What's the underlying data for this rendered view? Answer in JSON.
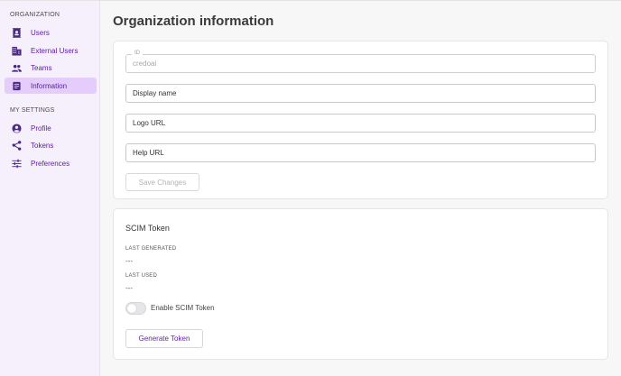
{
  "sidebar": {
    "organization_heading": "ORGANIZATION",
    "organization_items": [
      {
        "label": "Users",
        "icon": "contact-card-icon"
      },
      {
        "label": "External Users",
        "icon": "building-icon"
      },
      {
        "label": "Teams",
        "icon": "people-icon"
      },
      {
        "label": "Information",
        "icon": "document-icon",
        "active": true
      }
    ],
    "settings_heading": "MY SETTINGS",
    "settings_items": [
      {
        "label": "Profile",
        "icon": "account-circle-icon"
      },
      {
        "label": "Tokens",
        "icon": "share-nodes-icon"
      },
      {
        "label": "Preferences",
        "icon": "sliders-icon"
      }
    ]
  },
  "main": {
    "title": "Organization information",
    "form": {
      "id_legend": "ID",
      "id_value": "credoai",
      "display_name_placeholder": "Display name",
      "logo_url_placeholder": "Logo URL",
      "help_url_placeholder": "Help URL",
      "save_label": "Save Changes"
    },
    "scim": {
      "title": "SCIM Token",
      "last_generated_label": "LAST GENERATED",
      "last_generated_value": "---",
      "last_used_label": "LAST USED",
      "last_used_value": "---",
      "toggle_label": "Enable SCIM Token",
      "toggle_on": false,
      "generate_label": "Generate Token"
    }
  },
  "colors": {
    "accent": "#6a1fb8",
    "sidebar_bg": "#f6f0fd",
    "active_bg": "#e4cdfa"
  }
}
